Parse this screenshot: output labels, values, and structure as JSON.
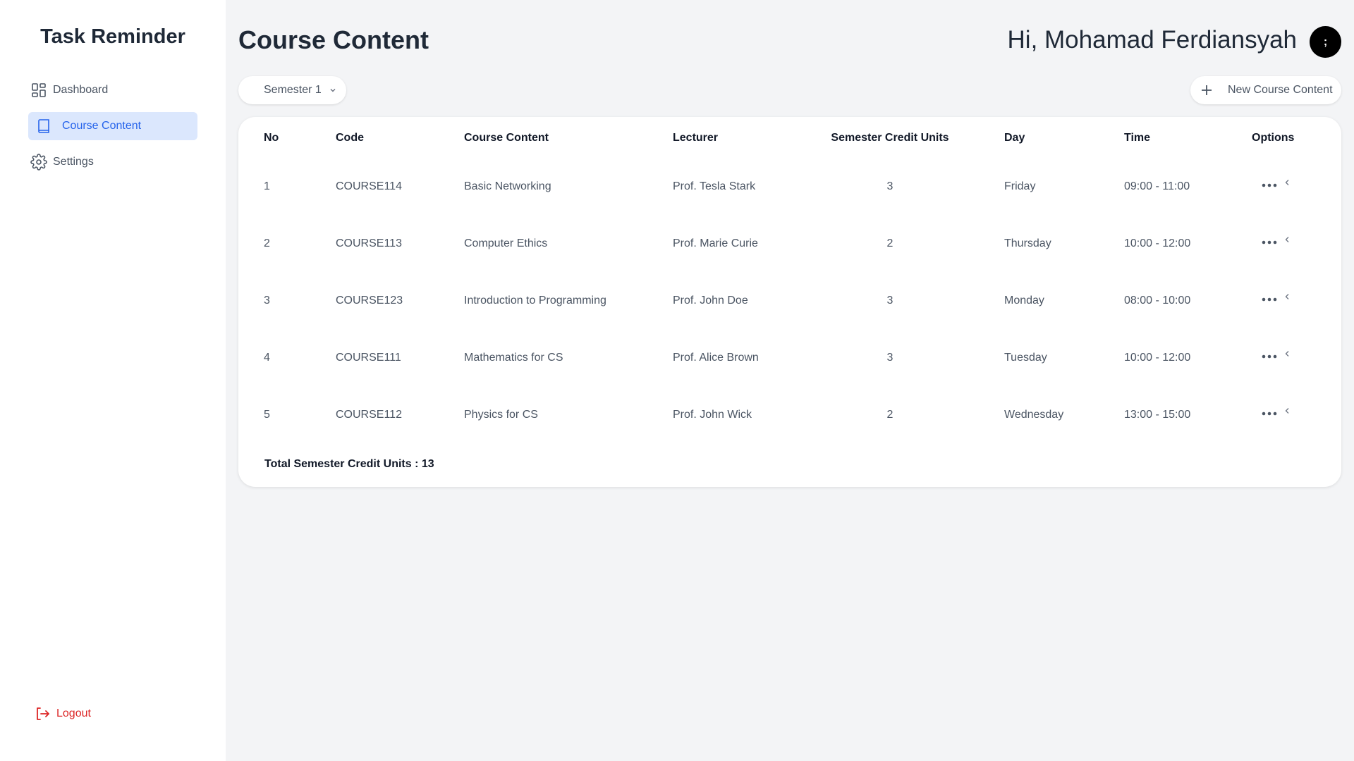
{
  "app": {
    "brand": "Task Reminder"
  },
  "sidebar": {
    "items": [
      {
        "label": "Dashboard",
        "icon": "dashboard-grid-icon",
        "active": false
      },
      {
        "label": "Course Content",
        "icon": "book-icon",
        "active": true
      },
      {
        "label": "Settings",
        "icon": "gear-icon",
        "active": false
      }
    ],
    "logout_label": "Logout"
  },
  "header": {
    "title": "Course Content",
    "greeting": "Hi, Mohamad Ferdiansyah",
    "avatar_text": ";"
  },
  "toolbar": {
    "semester_value": "Semester 1",
    "new_button_label": "New Course Content"
  },
  "table": {
    "headers": {
      "no": "No",
      "code": "Code",
      "course": "Course Content",
      "lecturer": "Lecturer",
      "scu": "Semester Credit Units",
      "day": "Day",
      "time": "Time",
      "options": "Options"
    },
    "rows": [
      {
        "no": "1",
        "code": "COURSE114",
        "course": "Basic Networking",
        "lecturer": "Prof. Tesla Stark",
        "scu": "3",
        "day": "Friday",
        "time": "09:00 - 11:00"
      },
      {
        "no": "2",
        "code": "COURSE113",
        "course": "Computer Ethics",
        "lecturer": "Prof. Marie Curie",
        "scu": "2",
        "day": "Thursday",
        "time": "10:00 - 12:00"
      },
      {
        "no": "3",
        "code": "COURSE123",
        "course": "Introduction to Programming",
        "lecturer": "Prof. John Doe",
        "scu": "3",
        "day": "Monday",
        "time": "08:00 - 10:00"
      },
      {
        "no": "4",
        "code": "COURSE111",
        "course": "Mathematics for CS",
        "lecturer": "Prof. Alice Brown",
        "scu": "3",
        "day": "Tuesday",
        "time": "10:00 - 12:00"
      },
      {
        "no": "5",
        "code": "COURSE112",
        "course": "Physics for CS",
        "lecturer": "Prof. John Wick",
        "scu": "2",
        "day": "Wednesday",
        "time": "13:00 - 15:00"
      }
    ],
    "total_label": "Total Semester Credit Units : 13"
  },
  "colors": {
    "accent": "#2563eb",
    "active_bg": "#dbe7fd",
    "danger": "#dc2626",
    "page_bg": "#f3f4f6"
  }
}
